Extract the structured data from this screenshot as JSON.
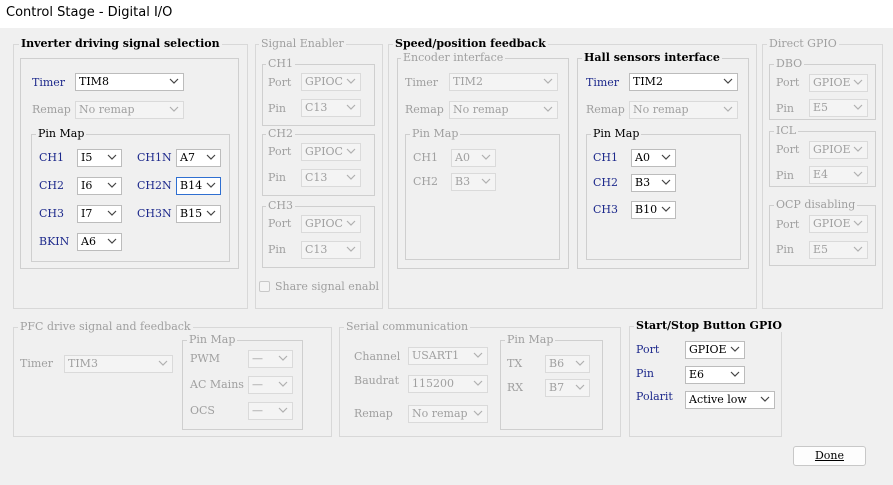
{
  "window": {
    "title": "Control Stage - Digital I/O"
  },
  "inverter": {
    "title": "Inverter driving signal selection",
    "timer_label": "Timer",
    "timer_value": "TIM8",
    "remap_label": "Remap",
    "remap_value": "No remap",
    "pinmap_title": "Pin Map",
    "ch1_label": "CH1",
    "ch1_value": "I5",
    "ch2_label": "CH2",
    "ch2_value": "I6",
    "ch3_label": "CH3",
    "ch3_value": "I7",
    "ch1n_label": "CH1N",
    "ch1n_value": "A7",
    "ch2n_label": "CH2N",
    "ch2n_value": "B14",
    "ch3n_label": "CH3N",
    "ch3n_value": "B15",
    "bkin_label": "BKIN",
    "bkin_value": "A6"
  },
  "signal_enabler": {
    "title": "Signal Enabler",
    "ch1_title": "CH1",
    "ch2_title": "CH2",
    "ch3_title": "CH3",
    "port_label": "Port",
    "pin_label": "Pin",
    "ch1_port": "GPIOC",
    "ch1_pin": "C13",
    "ch2_port": "GPIOC",
    "ch2_pin": "C13",
    "ch3_port": "GPIOC",
    "ch3_pin": "C13",
    "share_label": "Share signal enabl"
  },
  "speed": {
    "title": "Speed/position feedback",
    "encoder": {
      "title": "Encoder interface",
      "timer_label": "Timer",
      "timer_value": "TIM2",
      "remap_label": "Remap",
      "remap_value": "No remap",
      "pinmap_title": "Pin Map",
      "ch1_label": "CH1",
      "ch1_value": "A0",
      "ch2_label": "CH2",
      "ch2_value": "B3"
    },
    "hall": {
      "title": "Hall sensors interface",
      "timer_label": "Timer",
      "timer_value": "TIM2",
      "remap_label": "Remap",
      "remap_value": "No remap",
      "pinmap_title": "Pin Map",
      "ch1_label": "CH1",
      "ch1_value": "A0",
      "ch2_label": "CH2",
      "ch2_value": "B3",
      "ch3_label": "CH3",
      "ch3_value": "B10"
    }
  },
  "direct_gpio": {
    "title": "Direct GPIO",
    "dbo_title": "DBO",
    "icl_title": "ICL",
    "ocp_title": "OCP disabling",
    "port_label": "Port",
    "pin_label": "Pin",
    "dbo_port": "GPIOE",
    "dbo_pin": "E5",
    "icl_port": "GPIOE",
    "icl_pin": "E4",
    "ocp_port": "GPIOE",
    "ocp_pin": "E5"
  },
  "pfc": {
    "title": "PFC drive signal and feedback",
    "timer_label": "Timer",
    "timer_value": "TIM3",
    "pinmap_title": "Pin Map",
    "pwm_label": "PWM",
    "pwm_value": "—",
    "acmains_label": "AC Mains",
    "acmains_value": "—",
    "ocs_label": "OCS",
    "ocs_value": "—"
  },
  "serial": {
    "title": "Serial communication",
    "channel_label": "Channel",
    "channel_value": "USART1",
    "baud_label": "Baudrat",
    "baud_value": "115200",
    "remap_label": "Remap",
    "remap_value": "No remap",
    "pinmap_title": "Pin Map",
    "tx_label": "TX",
    "tx_value": "B6",
    "rx_label": "RX",
    "rx_value": "B7"
  },
  "startstop": {
    "title": "Start/Stop Button GPIO",
    "port_label": "Port",
    "port_value": "GPIOE",
    "pin_label": "Pin",
    "pin_value": "E6",
    "polarity_label": "Polarit",
    "polarity_value": "Active low"
  },
  "done_label": "Done"
}
